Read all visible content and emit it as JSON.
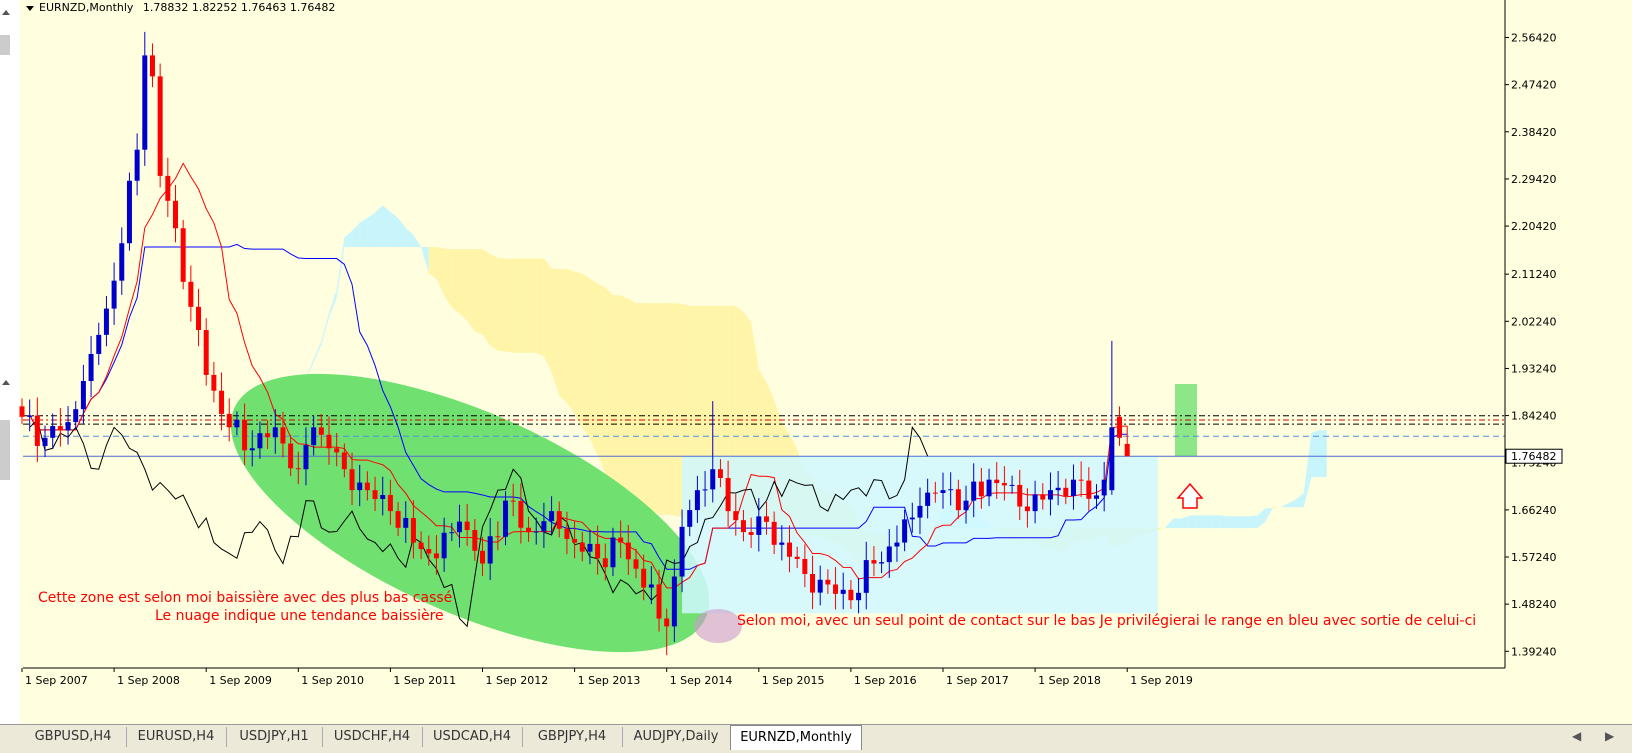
{
  "symbol_header": "EURNZD,Monthly",
  "ohlc": {
    "open": "1.78832",
    "high": "1.82252",
    "low": "1.76463",
    "close": "1.76482"
  },
  "current_price_label": "1.76482",
  "tabs": [
    "GBPUSD,H4",
    "EURUSD,H4",
    "USDJPY,H1",
    "USDCHF,H4",
    "USDCAD,H4",
    "GBPJPY,H4",
    "AUDJPY,Daily",
    "EURNZD,Monthly"
  ],
  "active_tab": "EURNZD,Monthly",
  "annotations": [
    {
      "text": "Cette zone est selon moi baissière avec des plus bas cassé",
      "color": "#ff0000"
    },
    {
      "text": "Le nuage indique une tendance baissière",
      "color": "#ff0000"
    },
    {
      "text": "Selon moi, avec un seul point de contact sur le bas Je privilégierai le range en bleu avec sortie de celui-ci",
      "color": "#ff0000"
    }
  ],
  "chart_data": {
    "type": "candlestick",
    "instrument": "EURNZD",
    "timeframe": "Monthly",
    "y_ticks": [
      2.5642,
      2.4742,
      2.3842,
      2.2942,
      2.2042,
      2.1124,
      2.0224,
      1.9324,
      1.8424,
      1.7524,
      1.6624,
      1.5724,
      1.4824,
      1.3924
    ],
    "y_tick_labels": [
      "2.56420",
      "2.47420",
      "2.38420",
      "2.29420",
      "2.20420",
      "2.11240",
      "2.02240",
      "1.93240",
      "1.84240",
      "1.75240",
      "1.66240",
      "1.57240",
      "1.48240",
      "1.39240"
    ],
    "x_tick_labels": [
      "1 Sep 2007",
      "1 Sep 2008",
      "1 Sep 2009",
      "1 Sep 2010",
      "1 Sep 2011",
      "1 Sep 2012",
      "1 Sep 2013",
      "1 Sep 2014",
      "1 Sep 2015",
      "1 Sep 2016",
      "1 Sep 2017",
      "1 Sep 2018",
      "1 Sep 2019"
    ],
    "ylim": [
      1.355,
      2.6
    ],
    "colors": {
      "bull": "#0000cc",
      "bear": "#ff0000",
      "tenkan": "#ff0000",
      "kijun": "#0000ff",
      "chikou": "#000000",
      "cloud_bull": "#c7f5fb",
      "cloud_bear": "#fff4a8",
      "highlight_green": "#70e070",
      "range_box": "#d0f8ff",
      "price_line": "#4f6fd0"
    },
    "horizontal_levels": [
      {
        "price": 1.842,
        "style": "dash-dot",
        "color": "#000000"
      },
      {
        "price": 1.834,
        "style": "dash-dot",
        "color": "#cc0000"
      },
      {
        "price": 1.826,
        "style": "dash-dot",
        "color": "#000000"
      },
      {
        "price": 1.803,
        "style": "dash",
        "color": "#4a8fe0"
      },
      {
        "price": 1.7648,
        "style": "solid",
        "color": "#4f6fd0"
      }
    ],
    "range_box": {
      "start_month": 86,
      "end_month": 148,
      "top": 1.7648,
      "bottom": 1.465
    },
    "candle_anchors": [
      [
        0,
        1.84
      ],
      [
        3,
        1.8
      ],
      [
        6,
        1.83
      ],
      [
        9,
        1.96
      ],
      [
        12,
        2.1
      ],
      [
        15,
        2.35
      ],
      [
        16,
        2.53
      ],
      [
        17,
        2.49
      ],
      [
        18,
        2.3
      ],
      [
        20,
        2.2
      ],
      [
        22,
        2.05
      ],
      [
        24,
        1.92
      ],
      [
        27,
        1.82
      ],
      [
        30,
        1.78
      ],
      [
        33,
        1.82
      ],
      [
        36,
        1.74
      ],
      [
        38,
        1.82
      ],
      [
        40,
        1.78
      ],
      [
        42,
        1.74
      ],
      [
        45,
        1.7
      ],
      [
        48,
        1.66
      ],
      [
        51,
        1.6
      ],
      [
        54,
        1.57
      ],
      [
        57,
        1.64
      ],
      [
        60,
        1.56
      ],
      [
        63,
        1.68
      ],
      [
        66,
        1.62
      ],
      [
        69,
        1.66
      ],
      [
        72,
        1.6
      ],
      [
        75,
        1.57
      ],
      [
        78,
        1.6
      ],
      [
        80,
        1.55
      ],
      [
        82,
        1.52
      ],
      [
        83,
        1.455
      ],
      [
        84,
        1.44
      ],
      [
        86,
        1.63
      ],
      [
        88,
        1.7
      ],
      [
        90,
        1.74
      ],
      [
        92,
        1.66
      ],
      [
        94,
        1.62
      ],
      [
        96,
        1.65
      ],
      [
        99,
        1.6
      ],
      [
        102,
        1.54
      ],
      [
        105,
        1.52
      ],
      [
        108,
        1.49
      ],
      [
        111,
        1.56
      ],
      [
        114,
        1.6
      ],
      [
        117,
        1.67
      ],
      [
        120,
        1.7
      ],
      [
        123,
        1.68
      ],
      [
        126,
        1.72
      ],
      [
        129,
        1.71
      ],
      [
        131,
        1.66
      ],
      [
        134,
        1.7
      ],
      [
        137,
        1.72
      ],
      [
        140,
        1.69
      ],
      [
        141,
        1.72
      ],
      [
        142,
        1.82
      ],
      [
        143,
        1.8
      ],
      [
        144,
        1.7648
      ]
    ]
  }
}
